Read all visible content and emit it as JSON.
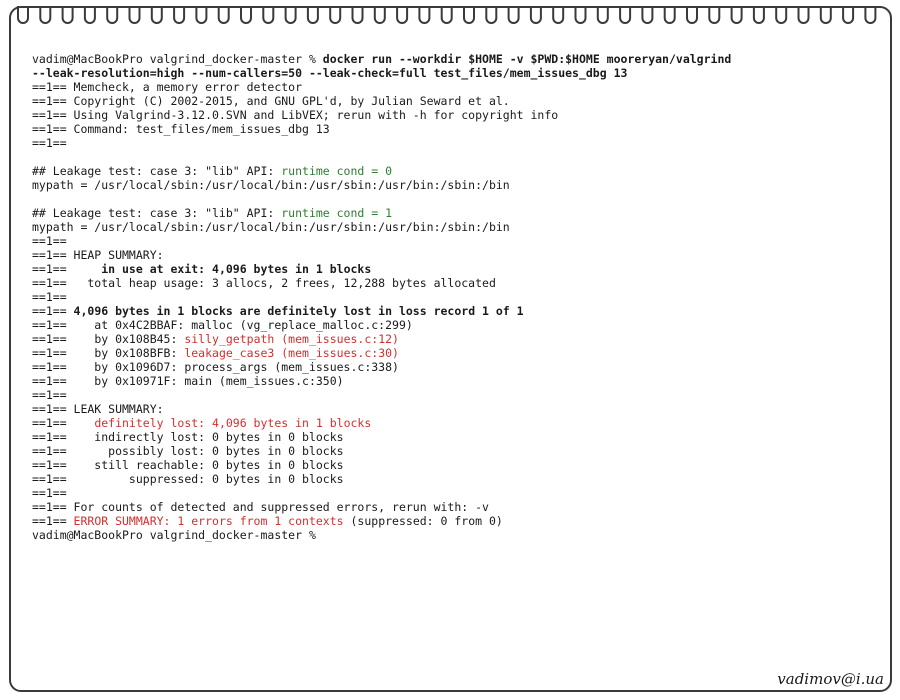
{
  "terminal": {
    "prompt": "vadim@MacBookPro valgrind_docker-master % ",
    "command_line1": "docker run --workdir $HOME -v $PWD:$HOME mooreryan/valgrind",
    "command_line2": "--leak-resolution=high --num-callers=50 --leak-check=full test_files/mem_issues_dbg 13",
    "header": [
      "==1== Memcheck, a memory error detector",
      "==1== Copyright (C) 2002-2015, and GNU GPL'd, by Julian Seward et al.",
      "==1== Using Valgrind-3.12.0.SVN and LibVEX; rerun with -h for copyright info",
      "==1== Command: test_files/mem_issues_dbg 13",
      "==1=="
    ],
    "case0_prefix": "## Leakage test: case 3: \"lib\" API: ",
    "case0_cond": "runtime cond = 0",
    "mypath0": "mypath = /usr/local/sbin:/usr/local/bin:/usr/sbin:/usr/bin:/sbin:/bin",
    "case1_prefix": "## Leakage test: case 3: \"lib\" API: ",
    "case1_cond": "runtime cond = 1",
    "mypath1": "mypath = /usr/local/sbin:/usr/local/bin:/usr/sbin:/usr/bin:/sbin:/bin",
    "sep": "==1==",
    "pfx": "==1== ",
    "heap_summary": "==1== HEAP SUMMARY:",
    "in_use": "    in use at exit: 4,096 bytes in 1 blocks",
    "total_heap": "==1==   total heap usage: 3 allocs, 2 frees, 12,288 bytes allocated",
    "lost_record": "4,096 bytes in 1 blocks are definitely lost in loss record 1 of 1",
    "at_line": "==1==    at 0x4C2BBAF: malloc (vg_replace_malloc.c:299)",
    "by1_prefix": "   by 0x108B45: ",
    "by1_func": "silly_getpath (mem_issues.c:12)",
    "by2_prefix": "   by 0x108BFB: ",
    "by2_func": "leakage_case3 (mem_issues.c:30)",
    "by3": "==1==    by 0x1096D7: process_args (mem_issues.c:338)",
    "by4": "==1==    by 0x10971F: main (mem_issues.c:350)",
    "leak_summary": "==1== LEAK SUMMARY:",
    "def_lost": "   definitely lost: 4,096 bytes in 1 blocks",
    "indirect": "==1==    indirectly lost: 0 bytes in 0 blocks",
    "possibly": "==1==      possibly lost: 0 bytes in 0 blocks",
    "reachable": "==1==    still reachable: 0 bytes in 0 blocks",
    "suppressed": "==1==         suppressed: 0 bytes in 0 blocks",
    "counts": "==1== For counts of detected and suppressed errors, rerun with: -v",
    "error_summary": "ERROR SUMMARY: 1 errors from 1 contexts",
    "error_suffix": " (suppressed: 0 from 0)",
    "final_prompt": "vadim@MacBookPro valgrind_docker-master %"
  },
  "signature": "vadimov@i.ua",
  "colors": {
    "green": "#2e7d32",
    "red": "#d32f2f",
    "text": "#1a1a1a",
    "border": "#3a3a3a"
  }
}
